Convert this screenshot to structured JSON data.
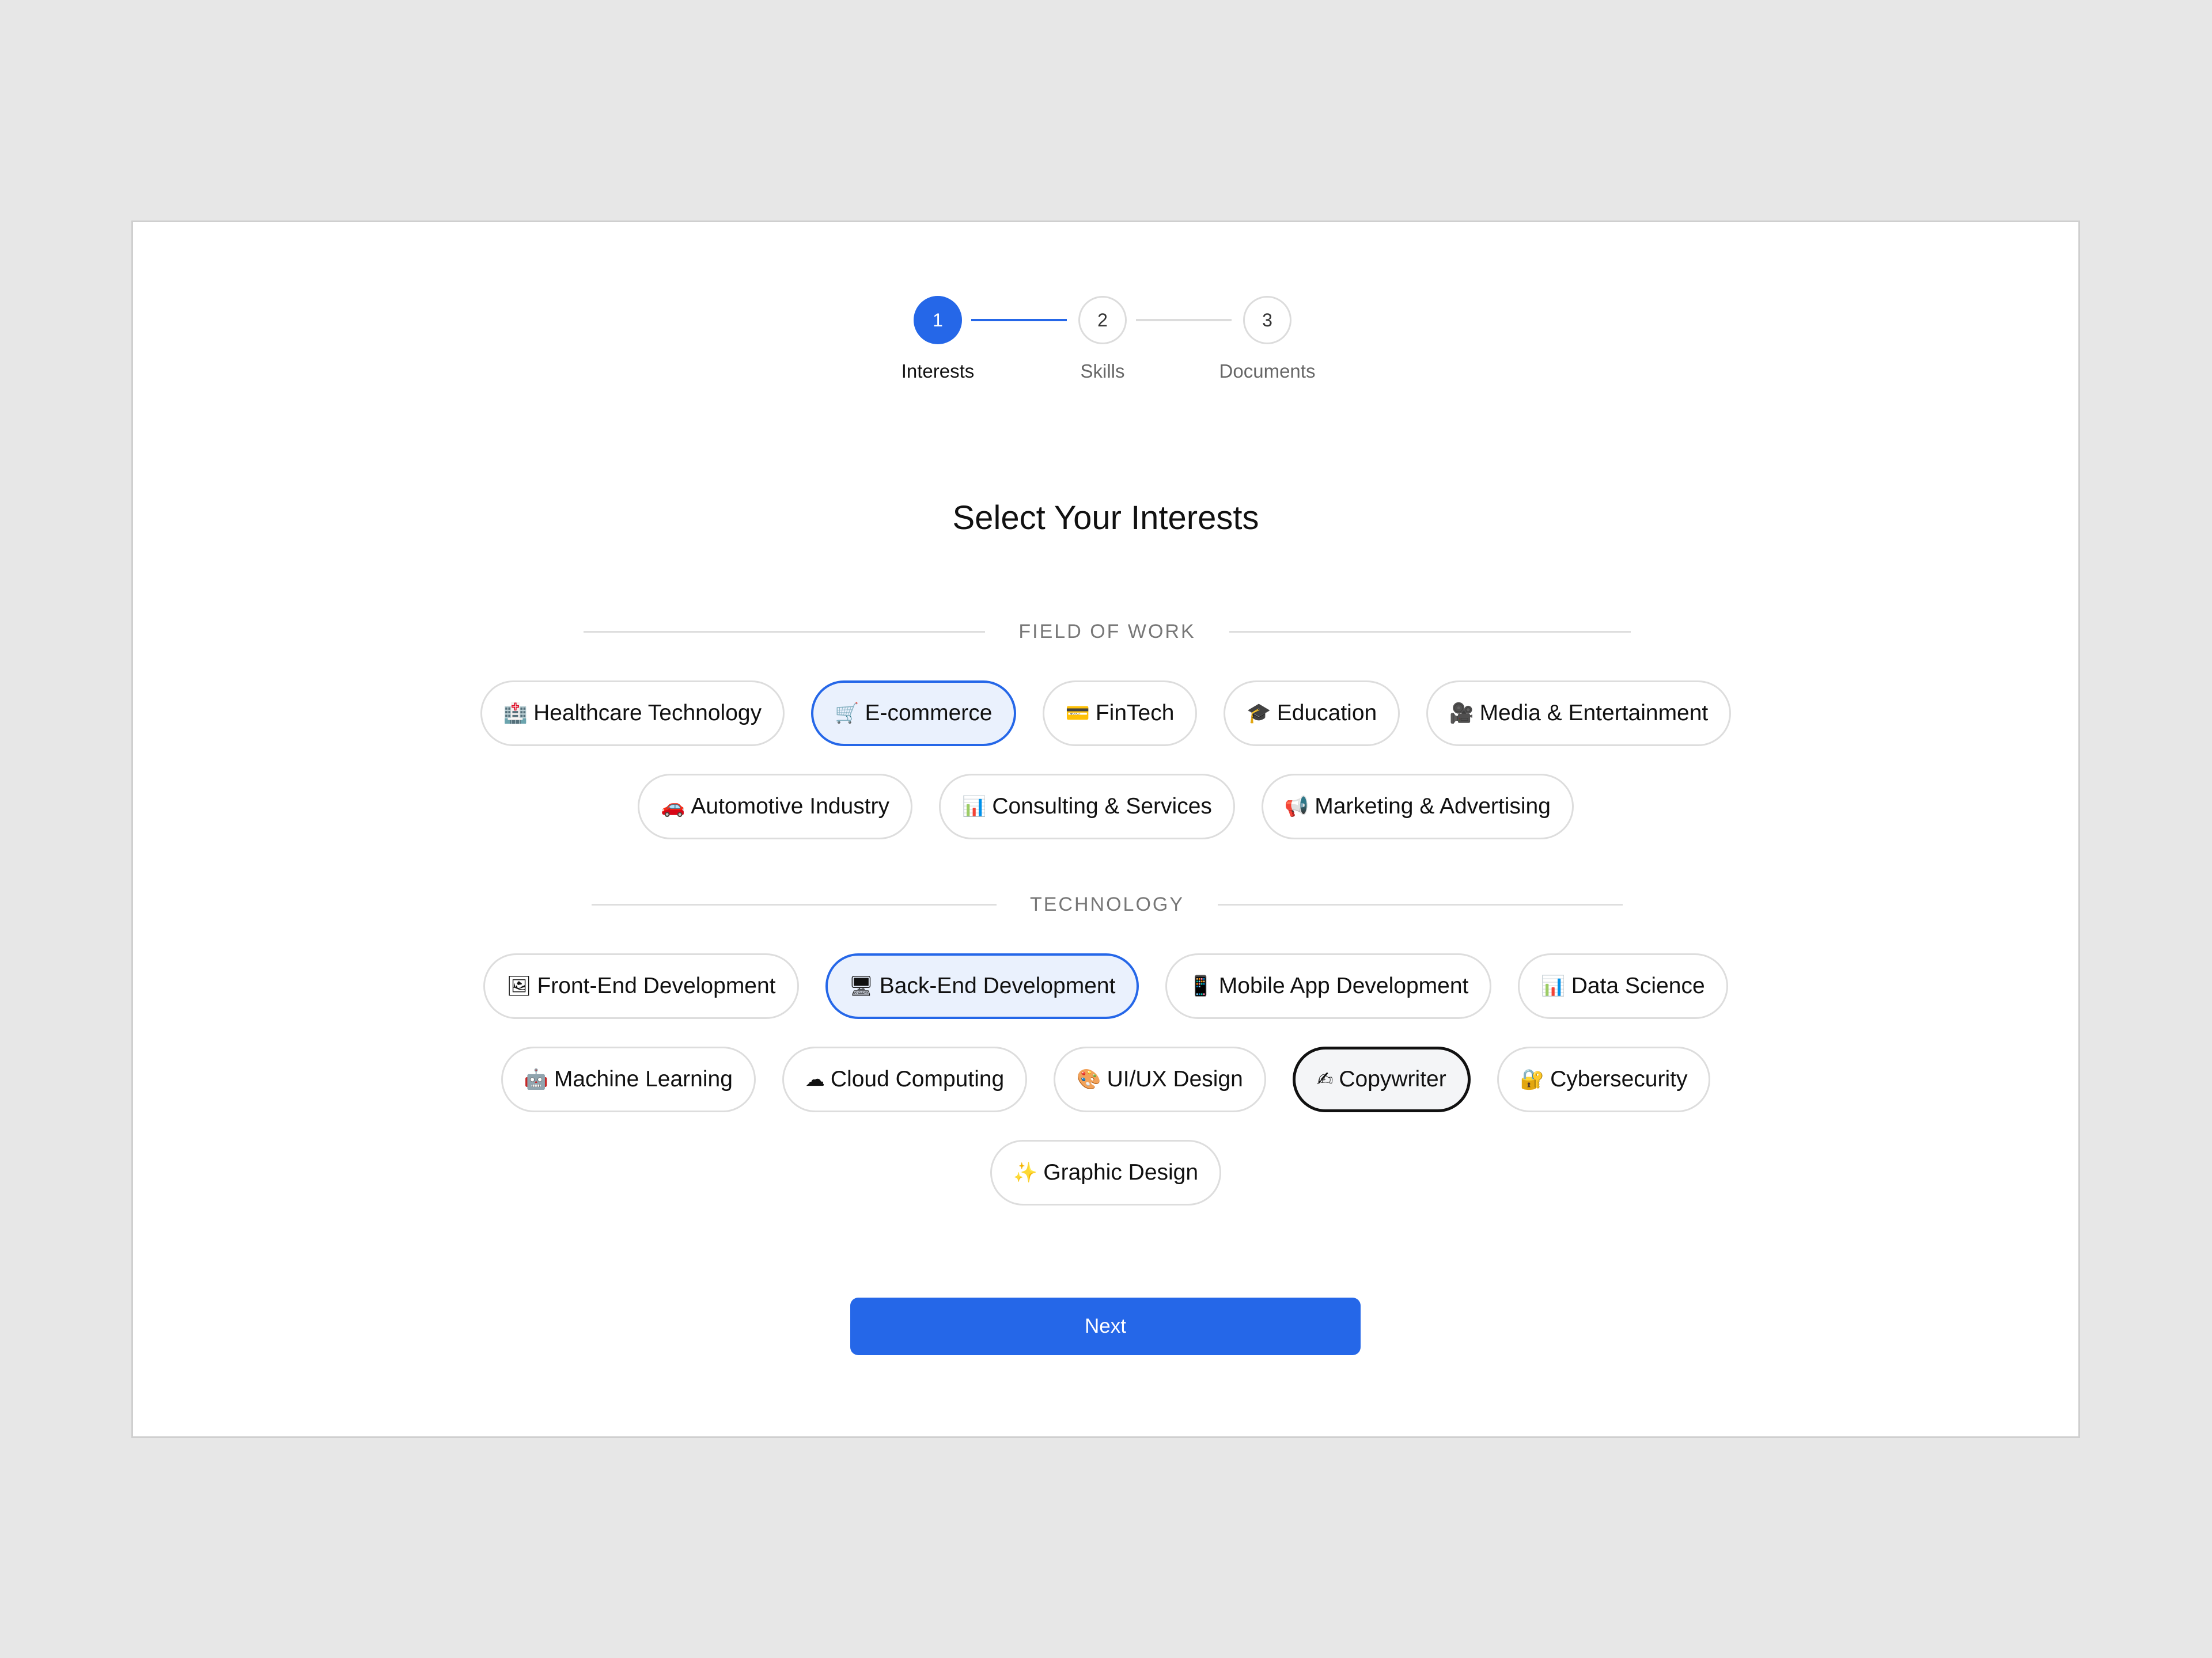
{
  "stepper": {
    "steps": [
      {
        "number": "1",
        "label": "Interests"
      },
      {
        "number": "2",
        "label": "Skills"
      },
      {
        "number": "3",
        "label": "Documents"
      }
    ]
  },
  "page": {
    "title": "Select Your Interests"
  },
  "sections": {
    "field_of_work": {
      "heading": "FIELD OF WORK",
      "chips": [
        {
          "icon": "🏥",
          "label": "Healthcare Technology"
        },
        {
          "icon": "🛒",
          "label": "E-commerce"
        },
        {
          "icon": "💳",
          "label": "FinTech"
        },
        {
          "icon": "🎓",
          "label": "Education"
        },
        {
          "icon": "🎥",
          "label": "Media & Entertainment"
        },
        {
          "icon": "🚗",
          "label": "Automotive Industry"
        },
        {
          "icon": "📊",
          "label": "Consulting & Services"
        },
        {
          "icon": "📢",
          "label": "Marketing & Advertising"
        }
      ]
    },
    "technology": {
      "heading": "TECHNOLOGY",
      "chips": [
        {
          "icon": "🖼",
          "label": "Front-End Development"
        },
        {
          "icon": "🖥",
          "label": "Back-End Development"
        },
        {
          "icon": "📱",
          "label": "Mobile App Development"
        },
        {
          "icon": "📊",
          "label": "Data Science"
        },
        {
          "icon": "🤖",
          "label": "Machine Learning"
        },
        {
          "icon": "☁",
          "label": "Cloud Computing"
        },
        {
          "icon": "🎨",
          "label": "UI/UX Design"
        },
        {
          "icon": "✍",
          "label": "Copywriter"
        },
        {
          "icon": "🔐",
          "label": "Cybersecurity"
        },
        {
          "icon": "✨",
          "label": "Graphic Design"
        }
      ]
    }
  },
  "actions": {
    "next_label": "Next"
  },
  "colors": {
    "accent": "#2567e8",
    "selected_bg": "#eaf1fd",
    "background": "#e7e7e7"
  }
}
